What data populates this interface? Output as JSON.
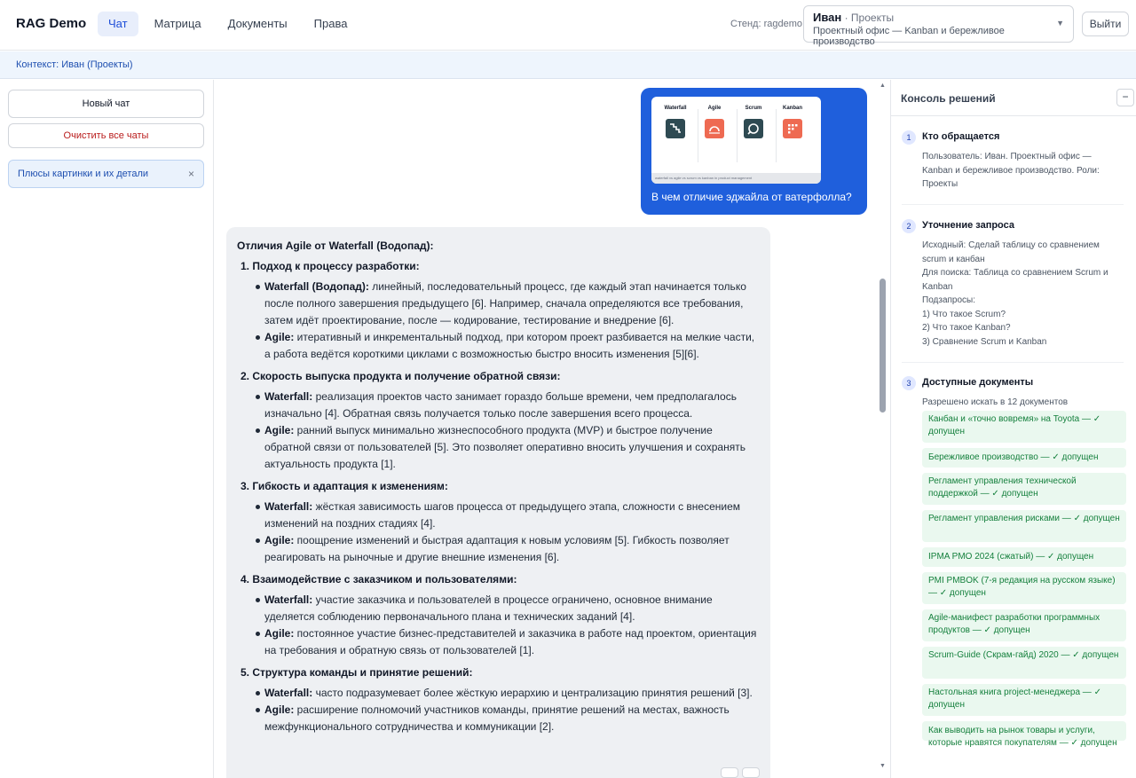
{
  "topbar": {
    "brand": "RAG Demo",
    "nav": [
      "Чат",
      "Матрица",
      "Документы",
      "Права"
    ],
    "stand": "Стенд: ragdemo",
    "user_name": "Иван",
    "user_sep": " · ",
    "user_project": "Проекты",
    "user_office": "Проектный офис — Kanban и бережливое производство",
    "logout": "Выйти"
  },
  "context": "Контекст: Иван (Проекты)",
  "sidebar": {
    "new_chat": "Новый чат",
    "clear_all": "Очистить все чаты",
    "chats": [
      {
        "title": "Плюсы картинки и их детали",
        "close": "×"
      }
    ]
  },
  "chat": {
    "user_message": {
      "image_columns": [
        "Waterfall",
        "Agile",
        "Scrum",
        "Kanban"
      ],
      "image_caption": "waterfall vs agile vs scrum vs kanban in product management",
      "text": "В чем отличие эджайла от ватерфолла?",
      "colors": {
        "bubble": "#1f5fdc",
        "dark_icon": "#2e4a52",
        "orange_icon": "#ee6a52"
      }
    },
    "bot_message": {
      "title": "Отличия Agile от Waterfall (Водопад):",
      "sections": [
        {
          "heading": "1. Подход к процессу разработки:",
          "items": [
            {
              "term": "Waterfall (Водопад):",
              "text": " линейный, последовательный процесс, где каждый этап начинается только после полного завершения предыдущего [6]. Например, сначала определяются все требования, затем идёт проектирование, после — кодирование, тестирование и внедрение [6]."
            },
            {
              "term": "Agile:",
              "text": " итеративный и инкрементальный подход, при котором проект разбивается на мелкие части, а работа ведётся короткими циклами с возможностью быстро вносить изменения [5][6]."
            }
          ]
        },
        {
          "heading": "2. Скорость выпуска продукта и получение обратной связи:",
          "items": [
            {
              "term": "Waterfall:",
              "text": " реализация проектов часто занимает гораздо больше времени, чем предполагалось изначально [4]. Обратная связь получается только после завершения всего процесса."
            },
            {
              "term": "Agile:",
              "text": " ранний выпуск минимально жизнеспособного продукта (MVP) и быстрое получение обратной связи от пользователей [5]. Это позволяет оперативно вносить улучшения и сохранять актуальность продукта [1]."
            }
          ]
        },
        {
          "heading": "3. Гибкость и адаптация к изменениям:",
          "items": [
            {
              "term": "Waterfall:",
              "text": " жёсткая зависимость шагов процесса от предыдущего этапа, сложности с внесением изменений на поздних стадиях [4]."
            },
            {
              "term": "Agile:",
              "text": " поощрение изменений и быстрая адаптация к новым условиям [5]. Гибкость позволяет реагировать на рыночные и другие внешние изменения [6]."
            }
          ]
        },
        {
          "heading": "4. Взаимодействие с заказчиком и пользователями:",
          "items": [
            {
              "term": "Waterfall:",
              "text": " участие заказчика и пользователей в процессе ограничено, основное внимание уделяется соблюдению первоначального плана и технических заданий [4]."
            },
            {
              "term": "Agile:",
              "text": " постоянное участие бизнес-представителей и заказчика в работе над проектом, ориентация на требования и обратную связь от пользователей [1]."
            }
          ]
        },
        {
          "heading": "5. Структура команды и принятие решений:",
          "items": [
            {
              "term": "Waterfall:",
              "text": " часто подразумевает более жёсткую иерархию и централизацию принятия решений [3]."
            },
            {
              "term": "Agile:",
              "text": " расширение полномочий участников команды, принятие решений на местах, важность межфункционального сотрудничества и коммуникации [2]."
            }
          ]
        }
      ]
    }
  },
  "console": {
    "title": "Консоль решений",
    "collapse": "−",
    "steps": [
      {
        "num": "1",
        "title": "Кто обращается",
        "body": [
          "Пользователь: Иван. Проектный офис — Kanban и бережливое производство. Роли: Проекты"
        ]
      },
      {
        "num": "2",
        "title": "Уточнение запроса",
        "body": [
          "Исходный: Сделай таблицу со сравнением scrum и канбан",
          "Для поиска: Таблица со сравнением Scrum и Kanban",
          "Подзапросы:",
          "1) Что такое Scrum?",
          "2) Что такое Kanban?",
          "3) Сравнение Scrum и Kanban"
        ]
      },
      {
        "num": "3",
        "title": "Доступные документы",
        "body": [
          "Разрешено искать в 12 документов"
        ]
      }
    ],
    "documents": [
      "Канбан и «точно вовремя» на Toyota — ✓ допущен",
      "Бережливое производство — ✓ допущен",
      "Регламент управления технической поддержкой — ✓ допущен",
      "Регламент управления рисками — ✓ допущен",
      "IPMA PMO 2024 (сжатый) — ✓ допущен",
      "PMI PMBOK (7-я редакция на русском языке) — ✓ допущен",
      "Agile-манифест разработки программных продуктов — ✓ допущен",
      "Scrum-Guide (Скрам-гайд) 2020 — ✓ допущен",
      "Настольная книга project-менеджера — ✓ допущен",
      "Как выводить на рынок товары и услуги, которые нравятся покупателям — ✓ допущен"
    ]
  }
}
